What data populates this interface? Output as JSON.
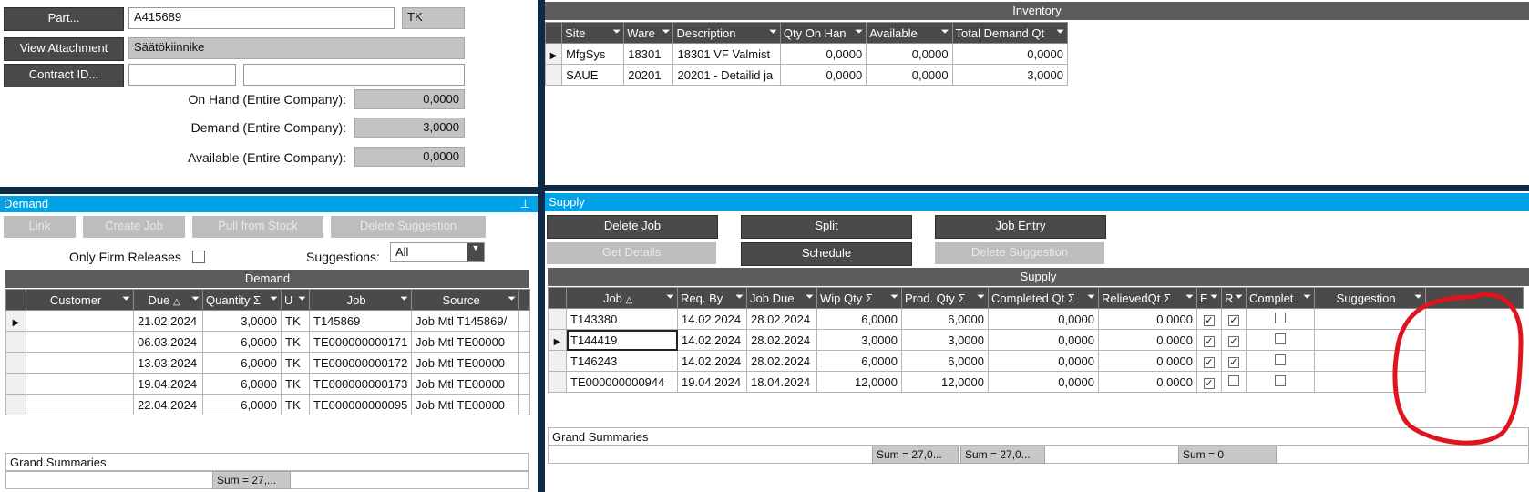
{
  "part_panel": {
    "part_button": "Part...",
    "part_value": "A415689",
    "uom": "TK",
    "view_attachment_button": "View Attachment",
    "description": "Säätökiinnike",
    "contract_button": "Contract ID...",
    "on_hand_label": "On Hand (Entire Company):",
    "on_hand_value": "0,0000",
    "demand_label": "Demand (Entire Company):",
    "demand_value": "3,0000",
    "available_label": "Available (Entire Company):",
    "available_value": "0,0000"
  },
  "inventory": {
    "title": "Inventory",
    "columns": [
      "Site",
      "Ware",
      "Description",
      "Qty On Han",
      "Available",
      "Total Demand Qt"
    ],
    "rows": [
      {
        "site": "MfgSys",
        "ware": "18301",
        "description": "18301 VF Valmist",
        "qty": "0,0000",
        "available": "0,0000",
        "total": "0,0000"
      },
      {
        "site": "SAUE",
        "ware": "20201",
        "description": "20201 - Detailid ja",
        "qty": "0,0000",
        "available": "0,0000",
        "total": "3,0000"
      }
    ]
  },
  "demand": {
    "panel_title": "Demand",
    "pin_icon": "pin-icon",
    "buttons": {
      "link": "Link",
      "create_job": "Create Job",
      "pull_from_stock": "Pull from Stock",
      "delete_suggestion": "Delete Suggestion"
    },
    "only_firm_label": "Only Firm Releases",
    "suggestions_label": "Suggestions:",
    "suggestions_value": "All",
    "grid_title": "Demand",
    "columns": [
      "Customer",
      "Due",
      "Quantity",
      "U",
      "Job",
      "Source"
    ],
    "rows": [
      {
        "customer": "",
        "due": "21.02.2024",
        "quantity": "3,0000",
        "u": "TK",
        "job": "T145869",
        "source": "Job Mtl T145869/"
      },
      {
        "customer": "",
        "due": "06.03.2024",
        "quantity": "6,0000",
        "u": "TK",
        "job": "TE000000000171",
        "source": "Job Mtl TE00000"
      },
      {
        "customer": "",
        "due": "13.03.2024",
        "quantity": "6,0000",
        "u": "TK",
        "job": "TE000000000172",
        "source": "Job Mtl TE00000"
      },
      {
        "customer": "",
        "due": "19.04.2024",
        "quantity": "6,0000",
        "u": "TK",
        "job": "TE000000000173",
        "source": "Job Mtl TE00000"
      },
      {
        "customer": "",
        "due": "22.04.2024",
        "quantity": "6,0000",
        "u": "TK",
        "job": "TE000000000095",
        "source": "Job Mtl TE00000"
      }
    ],
    "grand_summaries": "Grand Summaries",
    "sum_quantity": "Sum = 27,..."
  },
  "supply": {
    "panel_title": "Supply",
    "buttons": {
      "delete_job": "Delete Job",
      "split": "Split",
      "job_entry": "Job Entry",
      "get_details": "Get Details",
      "schedule": "Schedule",
      "delete_suggestion": "Delete Suggestion"
    },
    "grid_title": "Supply",
    "columns": [
      "Job",
      "Req. By",
      "Job Due",
      "Wip Qty",
      "Prod. Qty",
      "Completed Qt",
      "RelievedQt",
      "E",
      "R",
      "Complet",
      "Suggestion"
    ],
    "rows": [
      {
        "job": "T143380",
        "req_by": "14.02.2024",
        "job_due": "28.02.2024",
        "wip": "6,0000",
        "prod": "6,0000",
        "completed": "0,0000",
        "relieved": "0,0000",
        "e": true,
        "r": true,
        "complete": false
      },
      {
        "job": "T144419",
        "req_by": "14.02.2024",
        "job_due": "28.02.2024",
        "wip": "3,0000",
        "prod": "3,0000",
        "completed": "0,0000",
        "relieved": "0,0000",
        "e": true,
        "r": true,
        "complete": false
      },
      {
        "job": "T146243",
        "req_by": "14.02.2024",
        "job_due": "28.02.2024",
        "wip": "6,0000",
        "prod": "6,0000",
        "completed": "0,0000",
        "relieved": "0,0000",
        "e": true,
        "r": true,
        "complete": false
      },
      {
        "job": "TE000000000944",
        "req_by": "19.04.2024",
        "job_due": "18.04.2024",
        "wip": "12,0000",
        "prod": "12,0000",
        "completed": "0,0000",
        "relieved": "0,0000",
        "e": true,
        "r": false,
        "complete": false
      }
    ],
    "grand_summaries": "Grand Summaries",
    "sum_wip": "Sum = 27,0...",
    "sum_prod": "Sum = 27,0...",
    "sum_relieved": "Sum = 0"
  },
  "colors": {
    "accent_blue": "#00a2e8",
    "dark_button": "#4a4a4a",
    "annotation_red": "#e0141e"
  }
}
